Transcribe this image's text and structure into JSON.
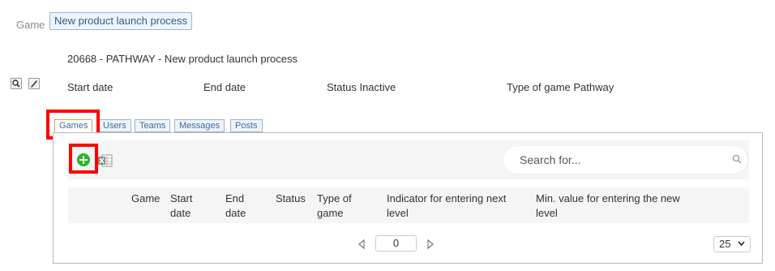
{
  "header": {
    "game_label": "Game",
    "game_name": "New product launch process",
    "title": "20668 - PATHWAY - New product launch process",
    "start_date": "Start date",
    "end_date": "End date",
    "status": "Status Inactive",
    "type": "Type of game Pathway"
  },
  "tabs": [
    {
      "label": "Games",
      "active": true
    },
    {
      "label": "Users"
    },
    {
      "label": "Teams"
    },
    {
      "label": "Messages"
    },
    {
      "label": "Posts"
    }
  ],
  "toolbar": {
    "add_icon": "plus-circle-icon",
    "export_icon": "excel-icon",
    "search_placeholder": "Search for..."
  },
  "table": {
    "columns": [
      [
        "Game"
      ],
      [
        "Start",
        "date"
      ],
      [
        "End",
        "date"
      ],
      [
        "Status"
      ],
      [
        "Type of",
        "game"
      ],
      [
        "Indicator for entering next",
        "level"
      ],
      [
        "Min. value for entering the new",
        "level"
      ]
    ]
  },
  "pagination": {
    "page": "0",
    "per_page": "25"
  },
  "colors": {
    "highlight": "#ff0000",
    "add_green": "#27b527",
    "tab_active_border": "#d0a850",
    "link_blue": "#3d6d9e"
  }
}
